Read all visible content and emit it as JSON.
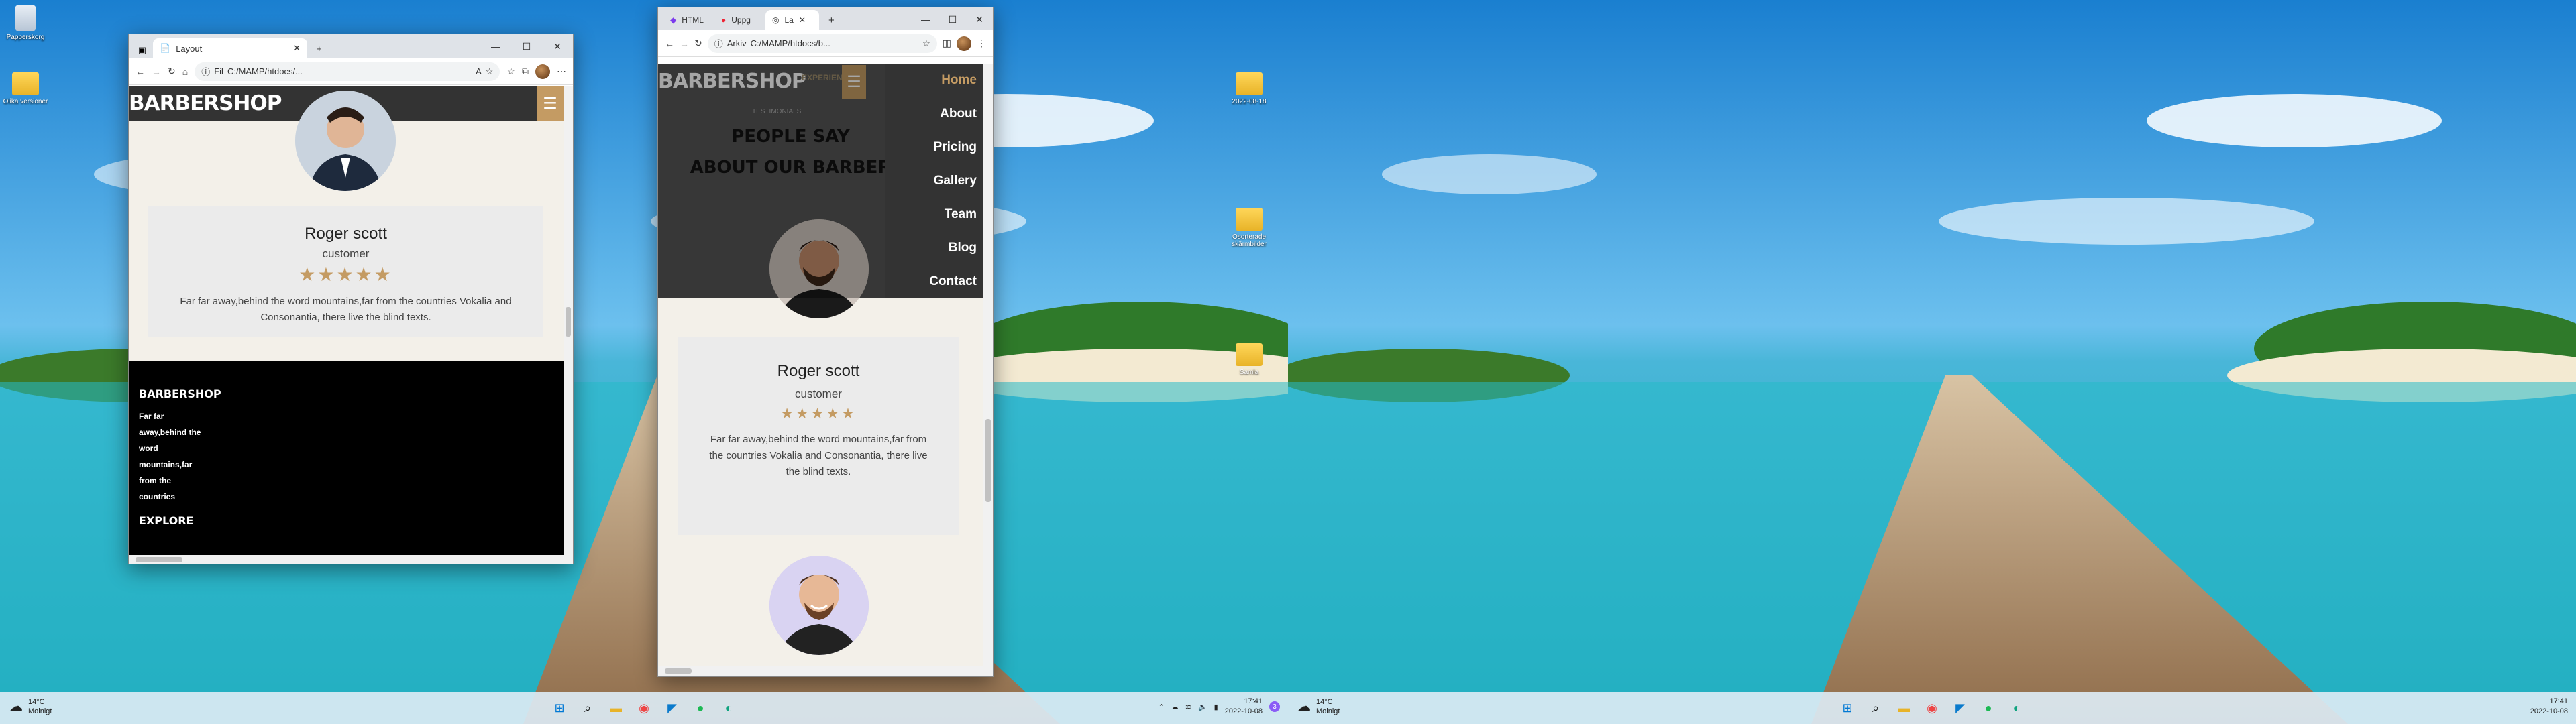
{
  "desktop_icons": [
    {
      "label": "Papperskorg",
      "kind": "bin"
    },
    {
      "label": "Olika versioner",
      "kind": "folder"
    },
    {
      "label": "2022-08-18",
      "kind": "folder"
    },
    {
      "label": "Osorterade skärmbilder",
      "kind": "folder"
    },
    {
      "label": "Samla",
      "kind": "folder"
    }
  ],
  "edge_window": {
    "tab_title": "Layout",
    "new_tab": "+",
    "url_prefix": "Fil",
    "url": "C:/MAMP/htdocs/...",
    "controls": [
      "—",
      "☐",
      "✕"
    ]
  },
  "chrome_window": {
    "tabs": [
      "HTML",
      "Uppg",
      "La"
    ],
    "new_tab": "+",
    "url_prefix": "Arkiv",
    "url": "C:/MAMP/htdocs/b...",
    "controls": [
      "—",
      "☐",
      "✕"
    ]
  },
  "site": {
    "brand": "BARBERSHOP",
    "menu_glyph": "☰",
    "nav_items": [
      "Home",
      "About",
      "Pricing",
      "Gallery",
      "Team",
      "Blog",
      "Contact"
    ],
    "section_heading_line1": "PEOPLE SAY",
    "section_heading_line2": "ABOUT OUR BARBER",
    "section_eyebrow": "TESTIMONIALS",
    "hero_badge": "EXPERIENCE",
    "testimonial": {
      "name": "Roger scott",
      "role": "customer",
      "stars": "★★★★★",
      "rating": 5,
      "quote": "Far far away,behind the word mountains,far from the countries Vokalia and Consonantia, there live the blind texts."
    },
    "footer": {
      "heading": "BARBERSHOP",
      "text": "Far far away,behind the word mountains,far from the countries",
      "explore": "EXPLORE"
    }
  },
  "taskbar": {
    "weather_temp": "14°C",
    "weather_desc": "Molnigt",
    "time": "17:41",
    "date": "2022-10-08",
    "notification_count": "3"
  },
  "colors": {
    "accent": "#c49b63",
    "nav_dark": "#333333",
    "page_bg": "#f3f0e9",
    "card_bg": "#ebebeb"
  }
}
